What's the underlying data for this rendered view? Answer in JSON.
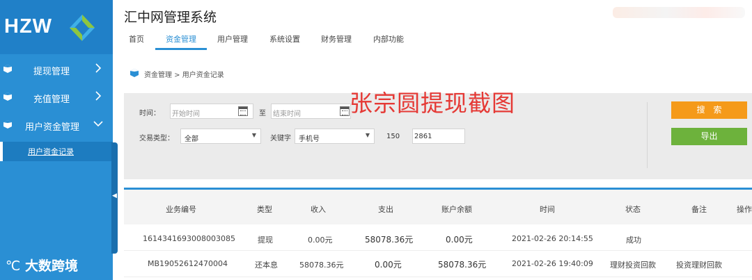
{
  "sidebar": {
    "logo_text": "HZW",
    "items": [
      {
        "label": "提现管理"
      },
      {
        "label": "充值管理"
      },
      {
        "label": "用户资金管理"
      }
    ],
    "sub_item": "用户资金记录",
    "handle_glyph": "◀"
  },
  "watermark": "大数跨境",
  "header": {
    "title": "汇中网管理系统",
    "tabs": [
      {
        "label": "首页"
      },
      {
        "label": "资金管理"
      },
      {
        "label": "用户管理"
      },
      {
        "label": "系统设置"
      },
      {
        "label": "财务管理"
      },
      {
        "label": "内部功能"
      }
    ],
    "active_tab": "资金管理"
  },
  "breadcrumb": "资金管理 > 用户资金记录",
  "overlay_text": "张宗圆提现截图",
  "filters": {
    "time_label": "时间：",
    "start_placeholder": "开始时间",
    "to_label": "至",
    "end_placeholder": "结束时间",
    "trade_type_label": "交易类型：",
    "trade_type_value": "全部",
    "keyword_label": "关键字",
    "keyword_type": "手机号",
    "phone_prefix": "150",
    "phone_suffix": "2861",
    "search_label": "搜索",
    "export_label": "导出"
  },
  "table": {
    "columns": [
      "业务编号",
      "类型",
      "收入",
      "支出",
      "账户余额",
      "时间",
      "状态",
      "备注",
      "操作"
    ],
    "rows": [
      {
        "id": "1614341693008003085",
        "type": "提现",
        "income": "0.00元",
        "expense": "58078.36元",
        "balance": "0.00元",
        "time": "2021-02-26 20:14:55",
        "status": "成功",
        "remark": ""
      },
      {
        "id": "MB19052612470004",
        "type": "还本息",
        "income": "58078.36元",
        "expense": "0.00元",
        "balance": "58078.36元",
        "time": "2021-02-26 19:40:09",
        "status": "理财投资回款",
        "remark": "投资理财回款"
      }
    ]
  },
  "colors": {
    "sidebar": "#2a8fd4",
    "accent": "#2a8fd4",
    "search_button": "#f59a1a",
    "export_button": "#6db23c",
    "overlay_text": "#e53935"
  }
}
